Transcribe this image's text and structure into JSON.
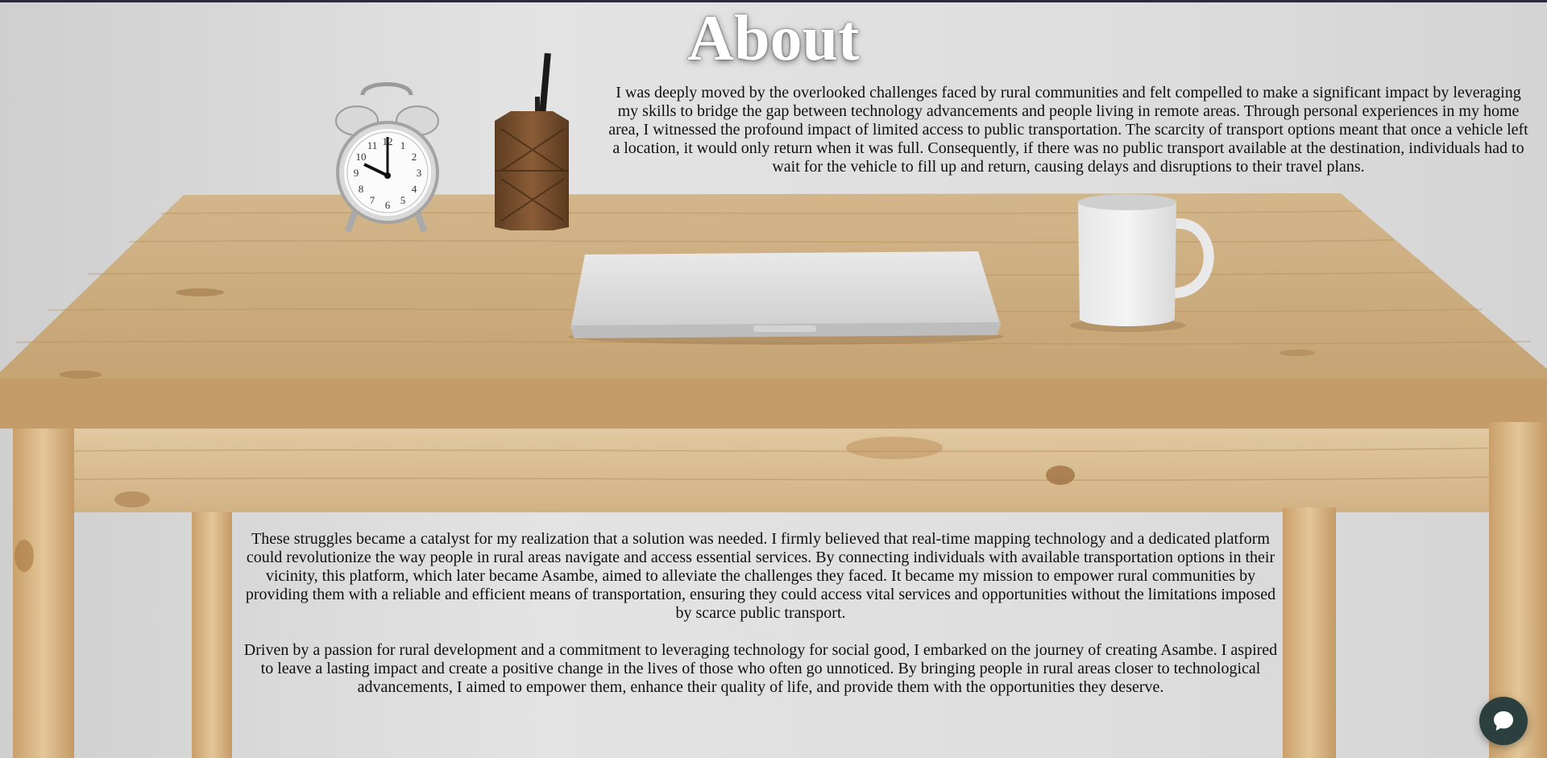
{
  "page": {
    "title": "About",
    "paragraphs": [
      "I was deeply moved by the overlooked challenges faced by rural communities and felt compelled to make a significant impact by leveraging my skills to bridge the gap between technology advancements and people living in remote areas. Through personal experiences in my home area, I witnessed the profound impact of limited access to public transportation. The scarcity of transport options meant that once a vehicle left a location, it would only return when it was full. Consequently, if there was no public transport available at the destination, individuals had to wait for the vehicle to fill up and return, causing delays and disruptions to their travel plans.",
      "These struggles became a catalyst for my realization that a solution was needed. I firmly believed that real-time mapping technology and a dedicated platform could revolutionize the way people in rural areas navigate and access essential services. By connecting individuals with available transportation options in their vicinity, this platform, which later became Asambe, aimed to alleviate the challenges they faced. It became my mission to empower rural communities by providing them with a reliable and efficient means of transportation, ensuring they could access vital services and opportunities without the limitations imposed by scarce public transport.",
      "Driven by a passion for rural development and a commitment to leveraging technology for social good, I embarked on the journey of creating Asambe. I aspired to leave a lasting impact and create a positive change in the lives of those who often go unnoticed. By bringing people in rural areas closer to technological advancements, I aimed to empower them, enhance their quality of life, and provide them with the opportunities they deserve."
    ]
  },
  "background": {
    "description_icon": "desk-photo",
    "clock": {
      "numerals": [
        "12",
        "1",
        "2",
        "3",
        "4",
        "5",
        "6",
        "7",
        "8",
        "9",
        "10",
        "11"
      ]
    }
  },
  "chat_widget": {
    "icon": "chat-bubble-icon"
  },
  "colors": {
    "title": "#ffffff",
    "text": "#0f0f0f",
    "wall": "#dcdcdc",
    "wood": "#c9a97a",
    "chat_button": "#2b3f3f"
  }
}
